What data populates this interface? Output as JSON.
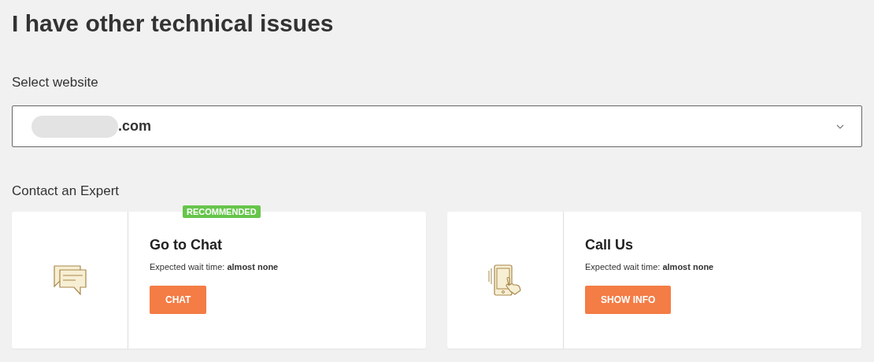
{
  "heading": "I have other technical issues",
  "website": {
    "label": "Select website",
    "value": ".com"
  },
  "contact": {
    "label": "Contact an Expert",
    "options": [
      {
        "kind": "chat",
        "badge": "RECOMMENDED",
        "title": "Go to Chat",
        "wait": "Expected wait time: **almost none**",
        "button": "CHAT"
      },
      {
        "kind": "phone",
        "title": "Call Us",
        "wait": "Expected wait time: **almost none**",
        "button": "SHOW INFO"
      }
    ]
  }
}
